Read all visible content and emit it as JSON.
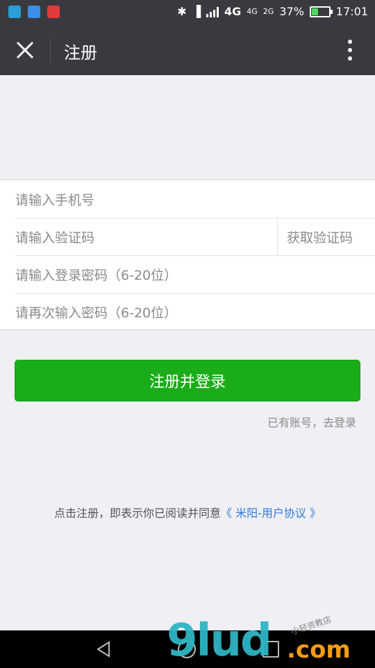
{
  "status_bar": {
    "apps": [
      "app-icon-1",
      "app-icon-2",
      "huawei-icon"
    ],
    "network_1": "4G",
    "network_2": "4G",
    "network_3": "2G",
    "battery_percent_text": "37%",
    "battery_level": 0.37,
    "time": "17:01"
  },
  "titlebar": {
    "close_icon": "close-icon",
    "title": "注册",
    "more_icon": "more-vertical-icon"
  },
  "form": {
    "phone_placeholder": "请输入手机号",
    "code_placeholder": "请输入验证码",
    "get_code_label": "获取验证码",
    "password_placeholder": "请输入登录密码（6-20位）",
    "password_confirm_placeholder": "请再次输入密码（6-20位）"
  },
  "submit_label": "注册并登录",
  "login_link": "已有账号，去登录",
  "agreement": {
    "prefix": "点击注册，即表示你已阅读并同意",
    "protocol": "《 米阳-用户协议 》"
  },
  "watermark": {
    "big": "9lud",
    "com": ".com",
    "small": "小轻资教店"
  },
  "colors": {
    "bar": "#393a3f",
    "primary": "#1aad19",
    "link": "#2e7bd6"
  }
}
